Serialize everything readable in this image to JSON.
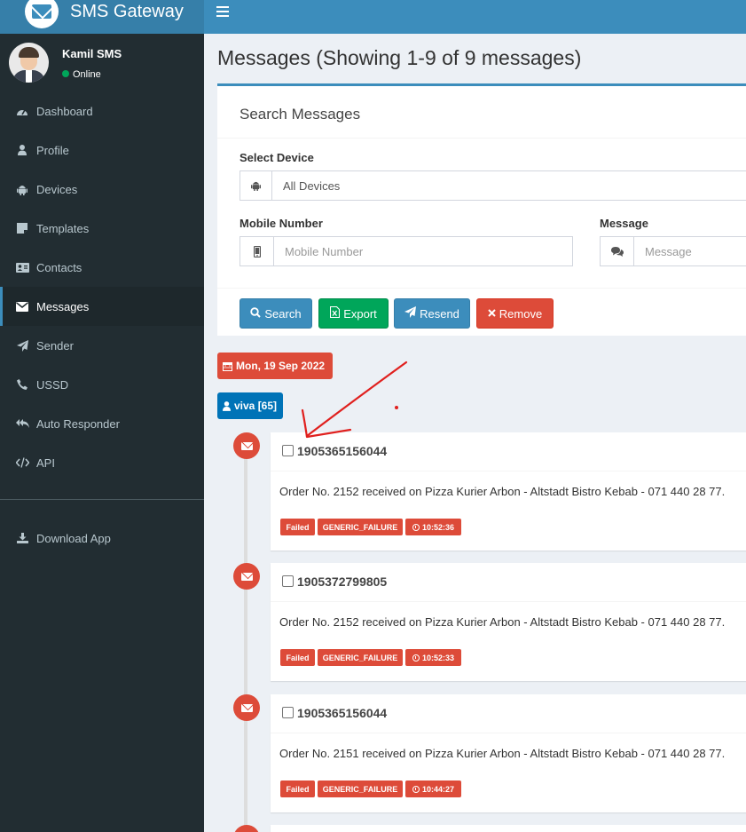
{
  "header": {
    "brand_name": "SMS Gateway",
    "brand_color": "#3c8dbc",
    "menu_icon": "hamburger-icon"
  },
  "user": {
    "name": "Kamil SMS",
    "status": "Online"
  },
  "sidebar": {
    "items": [
      {
        "label": "Dashboard",
        "icon": "dashboard-icon"
      },
      {
        "label": "Profile",
        "icon": "user-icon"
      },
      {
        "label": "Devices",
        "icon": "android-icon"
      },
      {
        "label": "Templates",
        "icon": "sticky-note-icon"
      },
      {
        "label": "Contacts",
        "icon": "address-card-icon"
      },
      {
        "label": "Messages",
        "icon": "envelope-icon",
        "active": true
      },
      {
        "label": "Sender",
        "icon": "paper-plane-icon"
      },
      {
        "label": "USSD",
        "icon": "phone-icon"
      },
      {
        "label": "Auto Responder",
        "icon": "reply-all-icon"
      },
      {
        "label": "API",
        "icon": "code-icon"
      }
    ],
    "download": {
      "label": "Download App",
      "icon": "download-icon"
    }
  },
  "main": {
    "title": "Messages (Showing 1-9 of 9 messages)",
    "search_box": {
      "title": "Search Messages",
      "device_label": "Select Device",
      "device_value": "All Devices",
      "mobile_label": "Mobile Number",
      "mobile_placeholder": "Mobile Number",
      "message_label": "Message",
      "message_placeholder": "Message",
      "buttons": {
        "search": "Search",
        "export": "Export",
        "resend": "Resend",
        "remove": "Remove"
      }
    },
    "timeline": {
      "date": "Mon, 19 Sep 2022",
      "group": "viva [65]",
      "messages": [
        {
          "number": "1905365156044",
          "text": "Order No. 2152 received on Pizza Kurier Arbon - Altstadt Bistro Kebab - 071 440 28 77.",
          "status": "Failed",
          "error": "GENERIC_FAILURE",
          "time": "10:52:36"
        },
        {
          "number": "1905372799805",
          "text": "Order No. 2152 received on Pizza Kurier Arbon - Altstadt Bistro Kebab - 071 440 28 77.",
          "status": "Failed",
          "error": "GENERIC_FAILURE",
          "time": "10:52:33"
        },
        {
          "number": "1905365156044",
          "text": "Order No. 2151 received on Pizza Kurier Arbon - Altstadt Bistro Kebab - 071 440 28 77.",
          "status": "Failed",
          "error": "GENERIC_FAILURE",
          "time": "10:44:27"
        }
      ]
    }
  }
}
